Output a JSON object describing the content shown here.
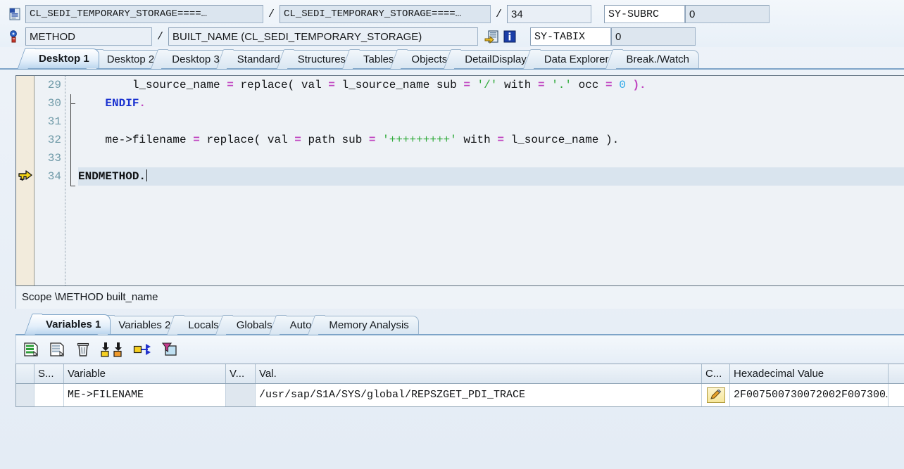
{
  "header": {
    "program_icon": "program-icon",
    "program": "CL_SEDI_TEMPORARY_STORAGE====…",
    "include": "CL_SEDI_TEMPORARY_STORAGE====…",
    "line": "34",
    "separator": "/",
    "sy_subrc_label": "SY-SUBRC",
    "sy_subrc_value": "0",
    "event_icon": "method-icon",
    "event_type": "METHOD",
    "event_name": "BUILT_NAME (CL_SEDI_TEMPORARY_STORAGE)",
    "goto_icon": "goto-source-icon",
    "info_icon": "info-icon",
    "sy_tabix_label": "SY-TABIX",
    "sy_tabix_value": "0"
  },
  "tabs": [
    {
      "label": "Desktop 1",
      "active": true
    },
    {
      "label": "Desktop 2",
      "active": false
    },
    {
      "label": "Desktop 3",
      "active": false
    },
    {
      "label": "Standard",
      "active": false
    },
    {
      "label": "Structures",
      "active": false
    },
    {
      "label": "Tables",
      "active": false
    },
    {
      "label": "Objects",
      "active": false
    },
    {
      "label": "DetailDisplay",
      "active": false
    },
    {
      "label": "Data Explorer",
      "active": false
    },
    {
      "label": "Break./Watch",
      "active": false
    }
  ],
  "source": {
    "lines": [
      {
        "no": "29",
        "current": false,
        "marker": false,
        "fold": "none"
      },
      {
        "no": "30",
        "current": false,
        "marker": false,
        "fold": "tick"
      },
      {
        "no": "31",
        "current": false,
        "marker": false,
        "fold": "none"
      },
      {
        "no": "32",
        "current": false,
        "marker": false,
        "fold": "none"
      },
      {
        "no": "33",
        "current": false,
        "marker": false,
        "fold": "none"
      },
      {
        "no": "34",
        "current": true,
        "marker": true,
        "fold": "end"
      }
    ],
    "code": {
      "l29": "        l_source_name = replace( val = l_source_name sub = '/' with = '.' occ = 0 ).",
      "l30": "    ENDIF.",
      "l31": "",
      "l32": "    me->filename = replace( val = path sub = '+++++++++' with = l_source_name ).",
      "l33": "",
      "l34": "ENDMETHOD."
    }
  },
  "scope": {
    "text": "Scope \\METHOD built_name"
  },
  "lower_tabs": [
    {
      "label": "Variables 1",
      "active": true
    },
    {
      "label": "Variables 2",
      "active": false
    },
    {
      "label": "Locals",
      "active": false
    },
    {
      "label": "Globals",
      "active": false
    },
    {
      "label": "Auto",
      "active": false
    },
    {
      "label": "Memory Analysis",
      "active": false
    }
  ],
  "var_toolbar": [
    {
      "name": "insert-row-icon"
    },
    {
      "name": "copy-row-icon"
    },
    {
      "name": "delete-row-icon"
    },
    {
      "name": "load-variables-icon"
    },
    {
      "name": "transfer-icon"
    },
    {
      "name": "filter-icon"
    }
  ],
  "grid": {
    "columns": [
      {
        "key": "sel",
        "label": ""
      },
      {
        "key": "s",
        "label": "S..."
      },
      {
        "key": "var",
        "label": "Variable"
      },
      {
        "key": "v",
        "label": "V..."
      },
      {
        "key": "val",
        "label": "Val."
      },
      {
        "key": "c",
        "label": "C..."
      },
      {
        "key": "hex",
        "label": "Hexadecimal Value"
      },
      {
        "key": "last",
        "label": ""
      }
    ],
    "rows": [
      {
        "s": "",
        "variable": "ME->FILENAME",
        "v": "",
        "value": "/usr/sap/S1A/SYS/global/REPSZGET_PDI_TRACE",
        "c_icon": "edit-pencil-icon",
        "hex": "2F007500730072002F007300…"
      }
    ]
  },
  "colors": {
    "keyword": "#1a32d0",
    "operator": "#c045c0",
    "string": "#2faa3a",
    "number": "#2aa8e8",
    "linenumber": "#6f9aa8",
    "marker_gutter": "#f2ebdc",
    "tab_active": "#bcd6ee"
  }
}
